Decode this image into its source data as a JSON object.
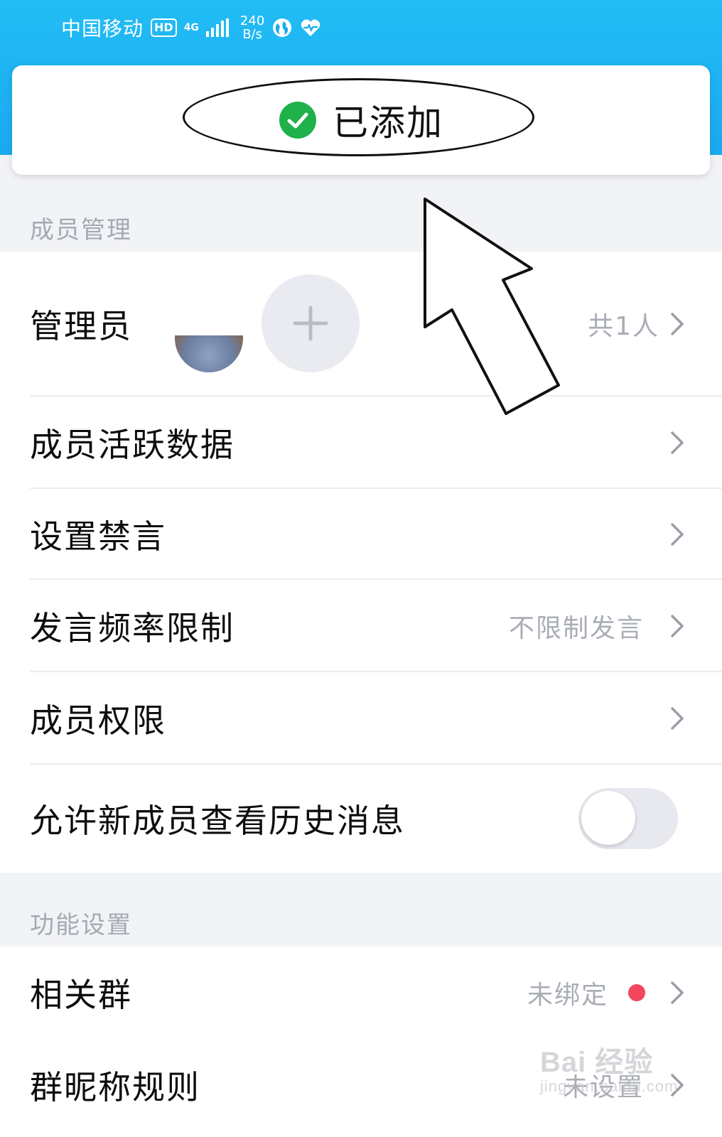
{
  "status_bar": {
    "carrier": "中国移动",
    "hd_badge": "HD",
    "network_type": "4G",
    "speed_value": "240",
    "speed_unit": "B/s",
    "icons": [
      "signal-icon",
      "browser-globe-icon",
      "health-heart-icon"
    ]
  },
  "toast": {
    "text": "已添加",
    "icon": "check-circle-icon",
    "accent_color": "#1fb14a"
  },
  "section_members": {
    "label": "成员管理",
    "rows": [
      {
        "title": "管理员",
        "value": "共1人"
      },
      {
        "title": "成员活跃数据",
        "value": ""
      },
      {
        "title": "设置禁言",
        "value": ""
      },
      {
        "title": "发言频率限制",
        "value": "不限制发言"
      },
      {
        "title": "成员权限",
        "value": ""
      },
      {
        "title": "允许新成员查看历史消息",
        "toggle_on": false
      }
    ]
  },
  "section_features": {
    "label": "功能设置",
    "rows": [
      {
        "title": "相关群",
        "value": "未绑定",
        "badge_color": "#f2475f"
      },
      {
        "title": "群昵称规则",
        "value": "未设置"
      }
    ]
  },
  "watermark": {
    "brand": "Bai 经验",
    "url": "jingyan.baidu.com"
  },
  "colors": {
    "header": "#1aa9ef",
    "background": "#f2f3f6",
    "secondary_text": "#a9adb5"
  }
}
